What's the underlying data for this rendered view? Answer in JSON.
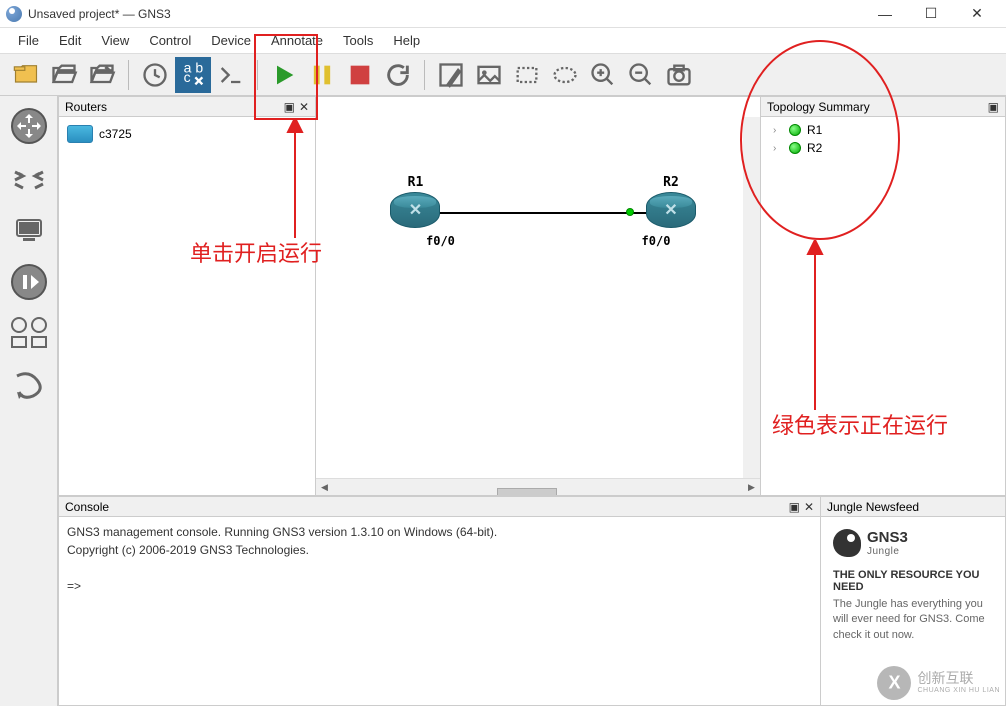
{
  "window": {
    "title": "Unsaved project* — GNS3",
    "minimize": "—",
    "maximize": "☐",
    "close": "✕"
  },
  "menu": {
    "file": "File",
    "edit": "Edit",
    "view": "View",
    "control": "Control",
    "device": "Device",
    "annotate": "Annotate",
    "tools": "Tools",
    "help": "Help"
  },
  "panels": {
    "routers": "Routers",
    "topology": "Topology Summary",
    "console": "Console",
    "newsfeed": "Jungle Newsfeed"
  },
  "routers": {
    "items": [
      {
        "name": "c3725"
      }
    ]
  },
  "topology": {
    "nodes": {
      "r1": {
        "label": "R1",
        "port": "f0/0"
      },
      "r2": {
        "label": "R2",
        "port": "f0/0"
      }
    }
  },
  "summary": {
    "items": [
      {
        "name": "R1"
      },
      {
        "name": "R2"
      }
    ]
  },
  "console": {
    "line1": "GNS3 management console. Running GNS3 version 1.3.10 on Windows (64-bit).",
    "line2": "Copyright (c) 2006-2019 GNS3 Technologies.",
    "prompt": "=>"
  },
  "newsfeed": {
    "brand": "GNS3",
    "sub": "Jungle",
    "headline": "THE ONLY RESOURCE YOU NEED",
    "text": "The Jungle has everything you will ever need for GNS3. Come check it out now."
  },
  "annotations": {
    "a1": "单击开启运行",
    "a2": "绿色表示正在运行"
  },
  "watermark": {
    "line1": "创新互联",
    "line2": "CHUANG XIN HU LIAN"
  },
  "panel_ctrl": {
    "detach": "▣",
    "close": "✕"
  }
}
